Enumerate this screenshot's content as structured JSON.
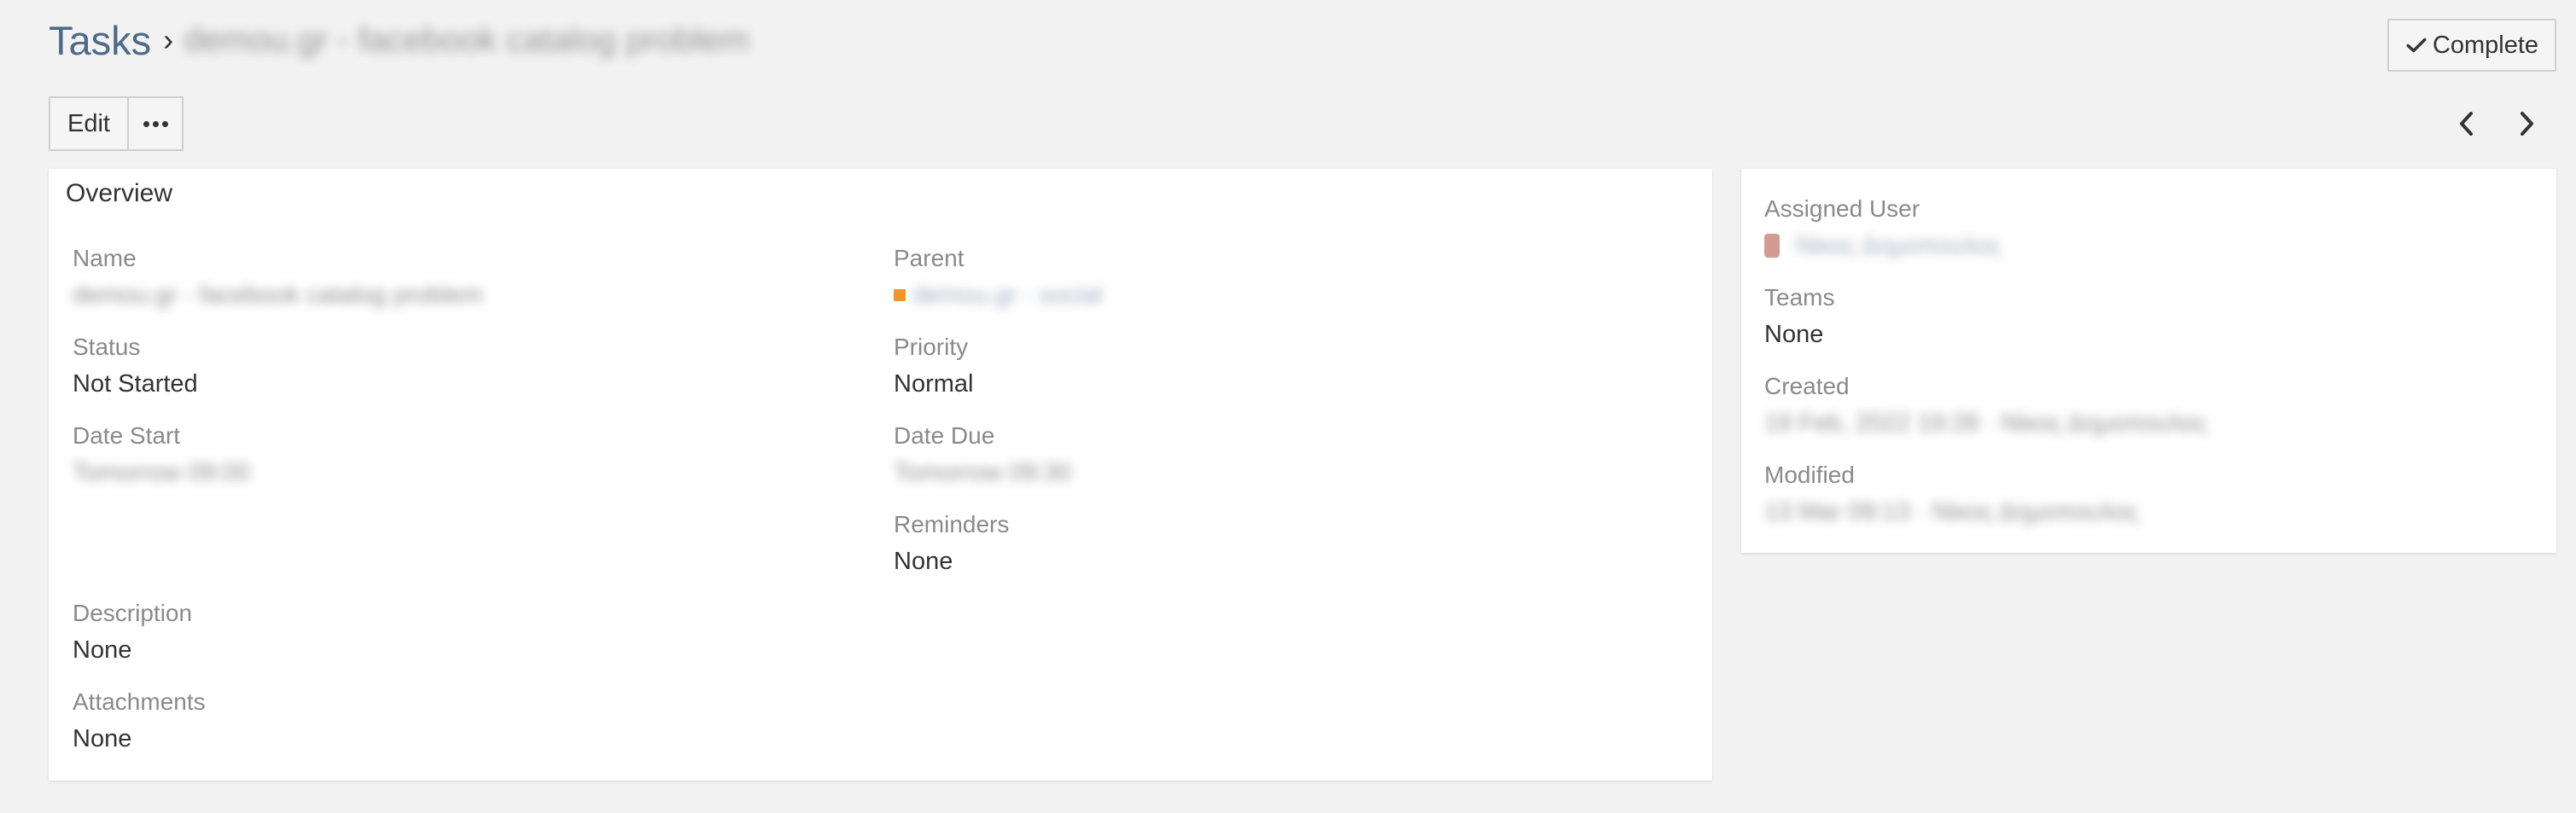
{
  "header": {
    "breadcrumb_root": "Tasks",
    "breadcrumb_separator": "›",
    "record_name": "demou.gr - facebook catalog problem",
    "complete_label": "Complete"
  },
  "actions": {
    "edit_label": "Edit"
  },
  "overview": {
    "heading": "Overview",
    "name": {
      "label": "Name",
      "value": "demou.gr - facebook catalog problem"
    },
    "parent": {
      "label": "Parent",
      "value": "demou.gr - social"
    },
    "status": {
      "label": "Status",
      "value": "Not Started"
    },
    "priority": {
      "label": "Priority",
      "value": "Normal"
    },
    "date_start": {
      "label": "Date Start",
      "value": "Tomorrow 09:00"
    },
    "date_due": {
      "label": "Date Due",
      "value": "Tomorrow 09:30"
    },
    "reminders": {
      "label": "Reminders",
      "value": "None"
    },
    "description": {
      "label": "Description",
      "value": "None"
    },
    "attachments": {
      "label": "Attachments",
      "value": "None"
    }
  },
  "side": {
    "assigned_user": {
      "label": "Assigned User",
      "value": "Νίκος Δημοπουλος"
    },
    "teams": {
      "label": "Teams",
      "value": "None"
    },
    "created": {
      "label": "Created",
      "value": "19 Feb, 2022 19:28 · Νίκος Δημοπουλος"
    },
    "modified": {
      "label": "Modified",
      "value": "13 Mar 09:13 · Νίκος Δημοπουλος"
    }
  },
  "colors": {
    "background": "#f2f2f2",
    "link": "#4c6a8a",
    "parent_marker": "#f0962a",
    "label": "#8a8a8a"
  },
  "icons": {
    "complete": "check-icon",
    "more": "ellipsis-icon",
    "prev": "chevron-left-icon",
    "next": "chevron-right-icon"
  }
}
